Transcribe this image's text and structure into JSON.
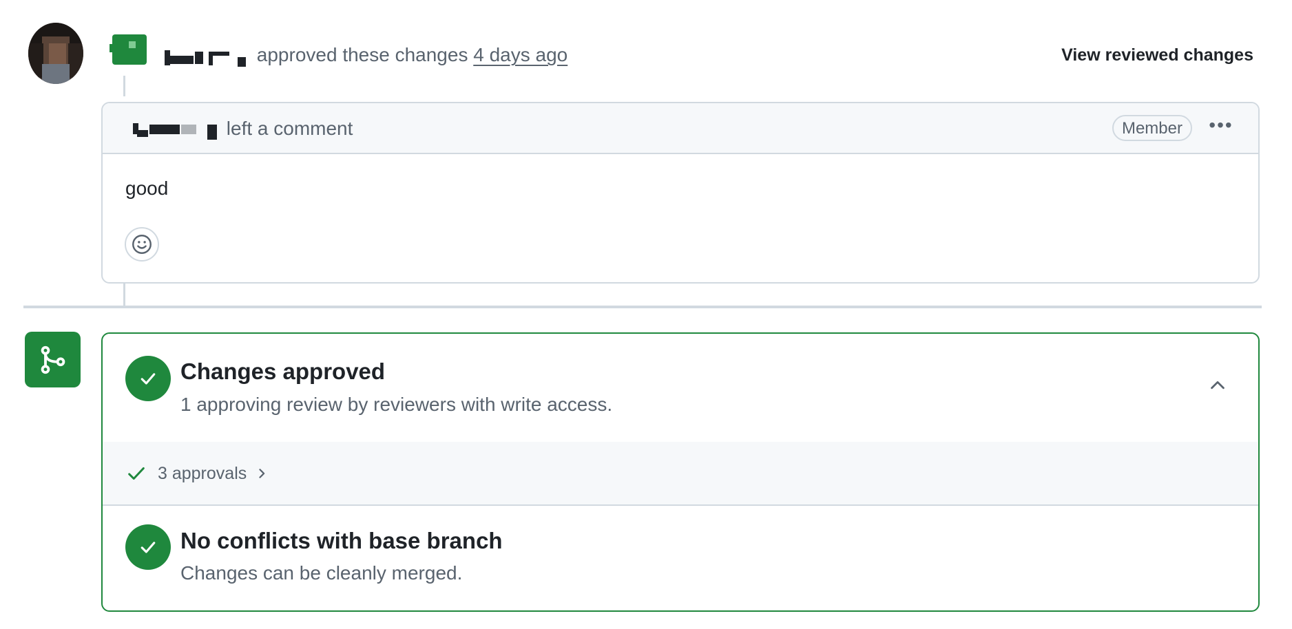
{
  "review_event": {
    "action_text": "approved these changes",
    "time": "4 days ago",
    "view_button": "View reviewed changes"
  },
  "comment": {
    "action_text": "left a comment",
    "role_badge": "Member",
    "more_label": "•••",
    "body": "good"
  },
  "merge_status": {
    "approved": {
      "title": "Changes approved",
      "subtitle": "1 approving review by reviewers with write access."
    },
    "approvals": {
      "label": "3 approvals"
    },
    "conflicts": {
      "title": "No conflicts with base branch",
      "subtitle": "Changes can be cleanly merged."
    }
  },
  "colors": {
    "success": "#1f883d",
    "border": "#d1d9e0",
    "muted": "#59636e"
  }
}
